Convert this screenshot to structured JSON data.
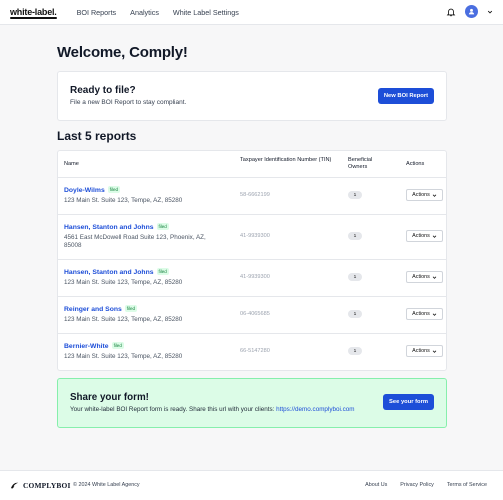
{
  "nav": {
    "logo": "white-label.",
    "items": [
      "BOI Reports",
      "Analytics",
      "White Label Settings"
    ],
    "avatar_color": "#4a6ee0"
  },
  "main": {
    "welcome": "Welcome, Comply!",
    "ready": {
      "title": "Ready to file?",
      "subtitle": "File a new BOI Report to stay compliant.",
      "button": "New BOI Report"
    },
    "reports_heading": "Last 5 reports",
    "columns": {
      "name": "Name",
      "tin": "Taxpayer Identification Number (TIN)",
      "owners": "Beneficial Owners",
      "actions": "Actions"
    },
    "rows": [
      {
        "name": "Doyle-Wilms",
        "status": "filed",
        "address": "123 Main St. Suite 123, Tempe, AZ, 85280",
        "tin": "58-6662199",
        "owners": "1",
        "action": "Actions"
      },
      {
        "name": "Hansen, Stanton and Johns",
        "status": "filed",
        "address": "4561 East McDowell Road Suite 123, Phoenix, AZ, 85008",
        "tin": "41-9939300",
        "owners": "1",
        "action": "Actions"
      },
      {
        "name": "Hansen, Stanton and Johns",
        "status": "filed",
        "address": "123 Main St. Suite 123, Tempe, AZ, 85280",
        "tin": "41-9939300",
        "owners": "1",
        "action": "Actions"
      },
      {
        "name": "Reinger and Sons",
        "status": "filed",
        "address": "123 Main St. Suite 123, Tempe, AZ, 85280",
        "tin": "06-4065685",
        "owners": "1",
        "action": "Actions"
      },
      {
        "name": "Bernier-White",
        "status": "filed",
        "address": "123 Main St. Suite 123, Tempe, AZ, 85280",
        "tin": "66-5147280",
        "owners": "1",
        "action": "Actions"
      }
    ],
    "share": {
      "title": "Share your form!",
      "text": "Your white-label BOI Report form is ready. Share this url with your clients:",
      "url": "https://demo.complyboi.com",
      "button": "See your form"
    }
  },
  "footer": {
    "brand": "COMPLYBOI",
    "copyright": "© 2024 White Label Agency",
    "links": [
      "About Us",
      "Privacy Policy",
      "Terms of Service"
    ]
  },
  "colors": {
    "accent": "#1d4ed8",
    "badge_bg": "#dcfce7",
    "badge_text": "#15803d",
    "share_bg": "#dcfce7"
  }
}
